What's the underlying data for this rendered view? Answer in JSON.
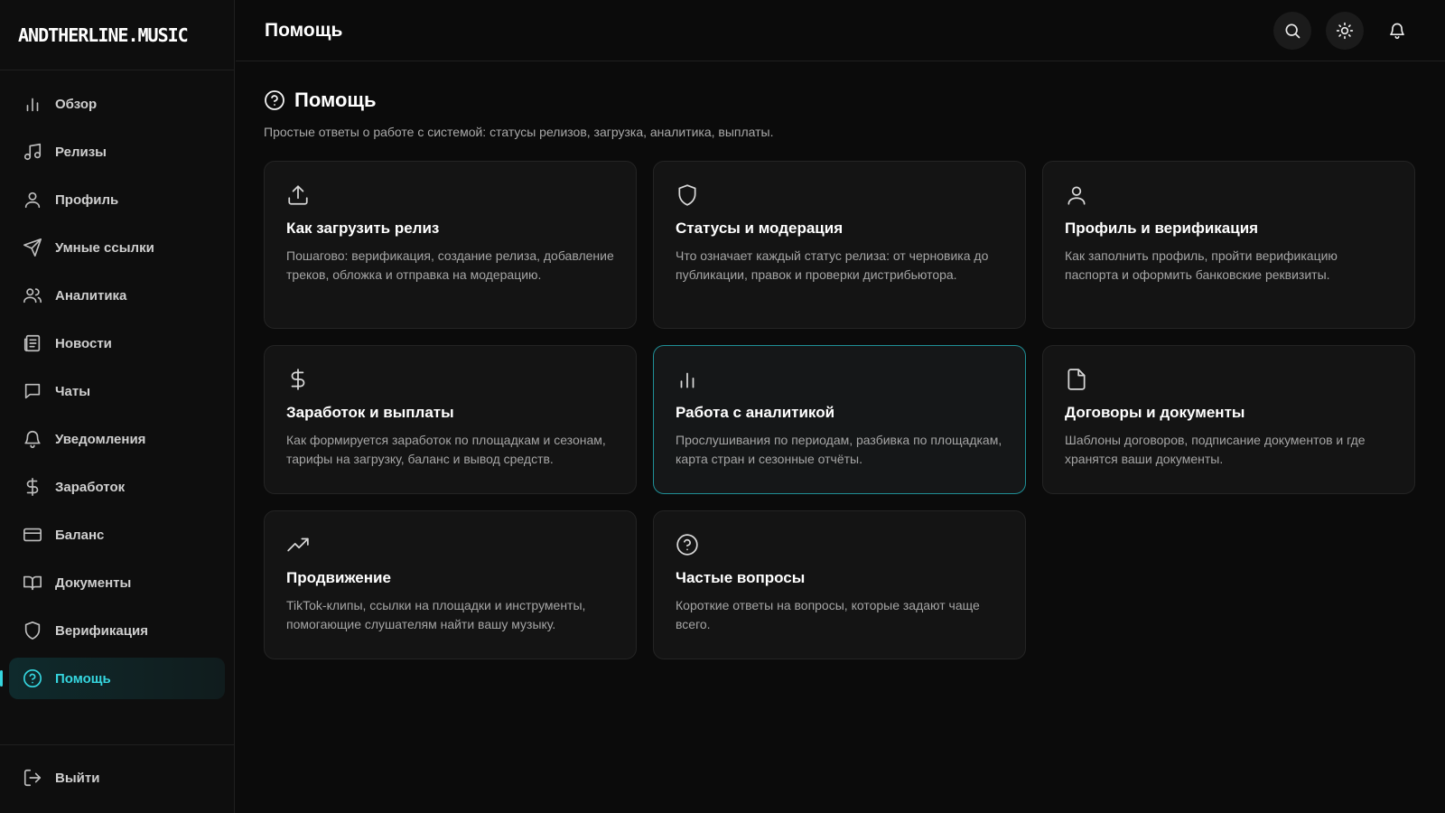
{
  "app": {
    "logo_text": "ANDTHERLINE.MUSIC"
  },
  "colors": {
    "accent": "#35d6df",
    "background": "#0b0b0b",
    "card": "#141414"
  },
  "sidebar": {
    "items": [
      {
        "label": "Обзор",
        "icon": "bar-chart-icon"
      },
      {
        "label": "Релизы",
        "icon": "music-note-icon"
      },
      {
        "label": "Профиль",
        "icon": "user-icon"
      },
      {
        "label": "Умные ссылки",
        "icon": "send-icon"
      },
      {
        "label": "Аналитика",
        "icon": "users-icon"
      },
      {
        "label": "Новости",
        "icon": "newspaper-icon"
      },
      {
        "label": "Чаты",
        "icon": "chat-icon"
      },
      {
        "label": "Уведомления",
        "icon": "bell-icon"
      },
      {
        "label": "Заработок",
        "icon": "dollar-icon"
      },
      {
        "label": "Баланс",
        "icon": "credit-card-icon"
      },
      {
        "label": "Документы",
        "icon": "book-icon"
      },
      {
        "label": "Верификация",
        "icon": "shield-icon"
      },
      {
        "label": "Помощь",
        "icon": "help-circle-icon",
        "active": true
      }
    ],
    "logout_label": "Выйти"
  },
  "header": {
    "title": "Помощь"
  },
  "main": {
    "title": "Помощь",
    "subtitle": "Простые ответы о работе с системой: статусы релизов, загрузка, аналитика, выплаты.",
    "cards": [
      {
        "title": "Как загрузить релиз",
        "text": "Пошагово: верификация, создание релиза, добавление треков, обложка и отправка на модерацию.",
        "icon": "upload-icon"
      },
      {
        "title": "Статусы и модерация",
        "text": "Что означает каждый статус релиза: от черновика до публикации, правок и проверки дистрибьютора.",
        "icon": "shield-icon"
      },
      {
        "title": "Профиль и верификация",
        "text": "Как заполнить профиль, пройти верификацию паспорта и оформить банковские реквизиты.",
        "icon": "user-icon"
      },
      {
        "title": "Заработок и выплаты",
        "text": "Как формируется заработок по площадкам и сезонам, тарифы на загрузку, баланс и вывод средств.",
        "icon": "dollar-icon"
      },
      {
        "title": "Работа с аналитикой",
        "text": "Прослушивания по периодам, разбивка по площадкам, карта стран и сезонные отчёты.",
        "icon": "bar-chart-icon"
      },
      {
        "title": "Договоры и документы",
        "text": "Шаблоны договоров, подписание документов и где хранятся ваши документы.",
        "icon": "file-icon"
      },
      {
        "title": "Продвижение",
        "text": "TikTok-клипы, ссылки на площадки и инструменты, помогающие слушателям найти вашу музыку.",
        "icon": "trending-up-icon"
      },
      {
        "title": "Частые вопросы",
        "text": "Короткие ответы на вопросы, которые задают чаще всего.",
        "icon": "help-circle-icon"
      }
    ]
  }
}
